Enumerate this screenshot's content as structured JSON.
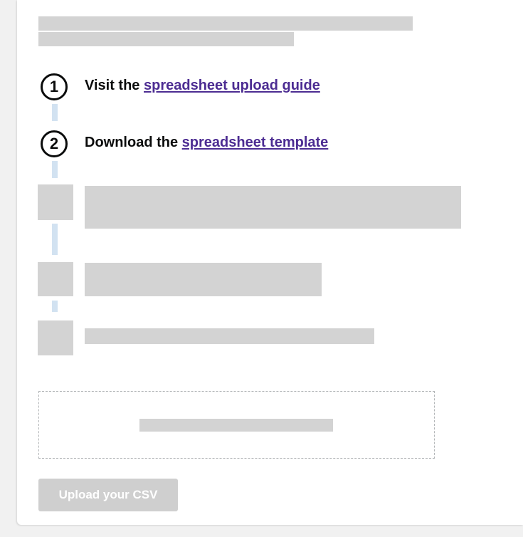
{
  "steps": [
    {
      "number": "1",
      "prefix": "Visit the ",
      "link": "spreadsheet upload guide"
    },
    {
      "number": "2",
      "prefix": "Download the ",
      "link": "spreadsheet template"
    }
  ],
  "upload": {
    "button_label": "Upload your CSV"
  },
  "colors": {
    "link": "#4c2c92",
    "text": "#0b0c0c",
    "placeholder": "#d3d3d3",
    "connector": "#d2e2f1",
    "button_disabled": "#cfcfcf"
  }
}
